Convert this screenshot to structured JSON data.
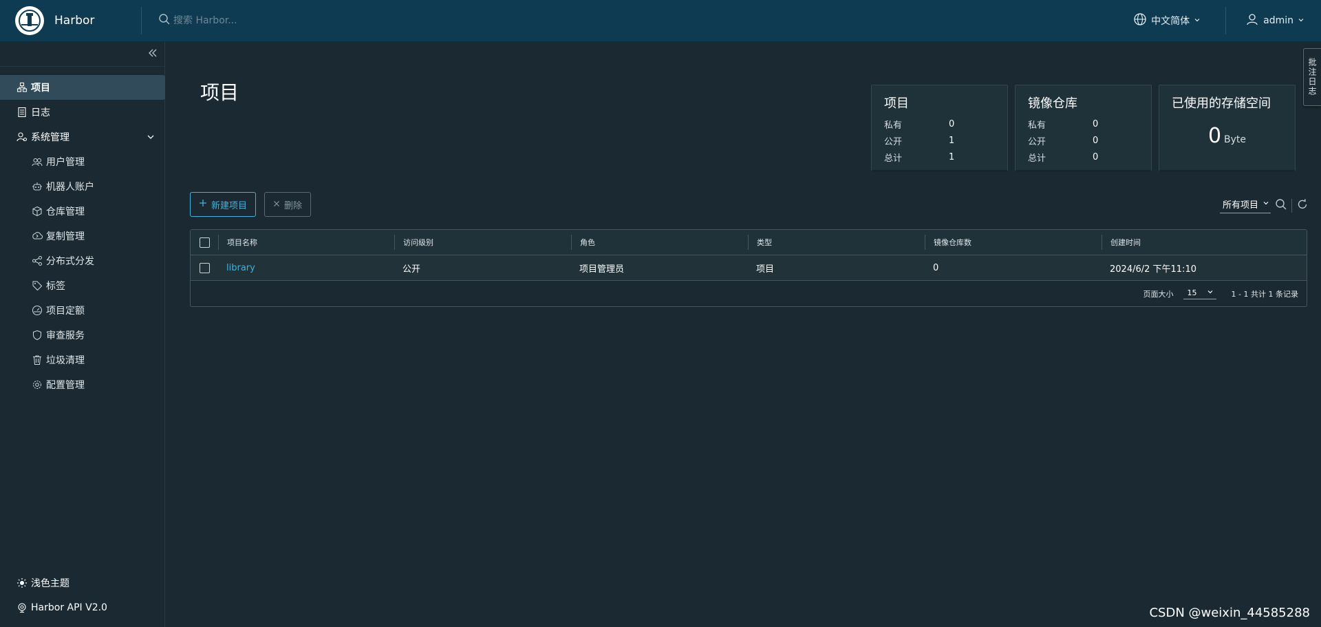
{
  "header": {
    "brand": "Harbor",
    "search_placeholder": "搜索 Harbor...",
    "language": "中文简体",
    "user": "admin"
  },
  "sidebar": {
    "items": [
      {
        "label": "项目",
        "icon": "projects-icon"
      },
      {
        "label": "日志",
        "icon": "logs-icon"
      },
      {
        "label": "系统管理",
        "icon": "admin-icon"
      }
    ],
    "sub_items": [
      {
        "label": "用户管理",
        "icon": "users-icon"
      },
      {
        "label": "机器人账户",
        "icon": "robot-icon"
      },
      {
        "label": "仓库管理",
        "icon": "registry-icon"
      },
      {
        "label": "复制管理",
        "icon": "replication-icon"
      },
      {
        "label": "分布式分发",
        "icon": "distribution-icon"
      },
      {
        "label": "标签",
        "icon": "tag-icon"
      },
      {
        "label": "项目定额",
        "icon": "quota-icon"
      },
      {
        "label": "审查服务",
        "icon": "shield-icon"
      },
      {
        "label": "垃圾清理",
        "icon": "trash-icon"
      },
      {
        "label": "配置管理",
        "icon": "gear-icon"
      }
    ],
    "bottom": [
      {
        "label": "浅色主题",
        "icon": "sun-icon"
      },
      {
        "label": "Harbor API V2.0",
        "icon": "api-icon"
      }
    ]
  },
  "main": {
    "title": "项目",
    "cards": {
      "projects": {
        "title": "项目",
        "rows": [
          {
            "label": "私有",
            "value": "0"
          },
          {
            "label": "公开",
            "value": "1"
          },
          {
            "label": "总计",
            "value": "1"
          }
        ]
      },
      "repos": {
        "title": "镜像仓库",
        "rows": [
          {
            "label": "私有",
            "value": "0"
          },
          {
            "label": "公开",
            "value": "0"
          },
          {
            "label": "总计",
            "value": "0"
          }
        ]
      },
      "storage": {
        "title": "已使用的存储空间",
        "value": "0",
        "unit": "Byte"
      }
    },
    "toolbar": {
      "new_label": "新建项目",
      "delete_label": "删除"
    },
    "filter": {
      "selected": "所有项目"
    },
    "table": {
      "columns": [
        "项目名称",
        "访问级别",
        "角色",
        "类型",
        "镜像仓库数",
        "创建时间"
      ],
      "rows": [
        {
          "name": "library",
          "access": "公开",
          "role": "项目管理员",
          "type": "项目",
          "repo_count": "0",
          "created": "2024/6/2 下午11:10"
        }
      ],
      "footer": {
        "page_size_label": "页面大小",
        "page_size": "15",
        "summary": "1 - 1 共计 1 条记录"
      }
    }
  },
  "side_tab": "批注日志",
  "watermark": "CSDN @weixin_44585288",
  "colors": {
    "header": "#0f3b52",
    "background": "#1b2a32",
    "accent": "#49afd9",
    "active_nav": "#324b5a"
  }
}
